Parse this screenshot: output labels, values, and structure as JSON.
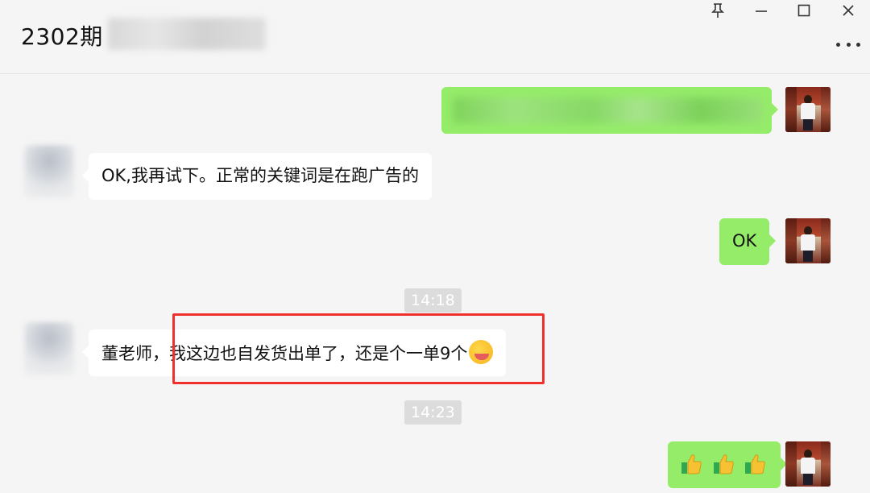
{
  "window": {
    "title": "2302期",
    "controls": [
      "pin-icon",
      "minimize-icon",
      "maximize-icon",
      "close-icon"
    ],
    "more_icon": "more-dots-icon"
  },
  "messages": [
    {
      "side": "out",
      "text": "",
      "blurred": true
    },
    {
      "side": "in",
      "text": "OK,我再试下。正常的关键词是在跑广告的"
    },
    {
      "side": "out",
      "text": "OK"
    },
    {
      "type": "time",
      "text": "14:18"
    },
    {
      "side": "in",
      "text": "董老师，我这边也自发货出单了，还是个一单9个",
      "emoji": "grinning-money-face-icon",
      "highlighted": true
    },
    {
      "type": "time",
      "text": "14:23"
    },
    {
      "side": "out",
      "emojis": [
        "thumbs-up-icon",
        "thumbs-up-icon",
        "thumbs-up-icon"
      ]
    }
  ],
  "colors": {
    "outgoing_bubble": "#95ec69",
    "incoming_bubble": "#ffffff",
    "background": "#f5f5f5",
    "highlight_box": "#f0302c",
    "timestamp_bg": "#dcdcdc"
  }
}
